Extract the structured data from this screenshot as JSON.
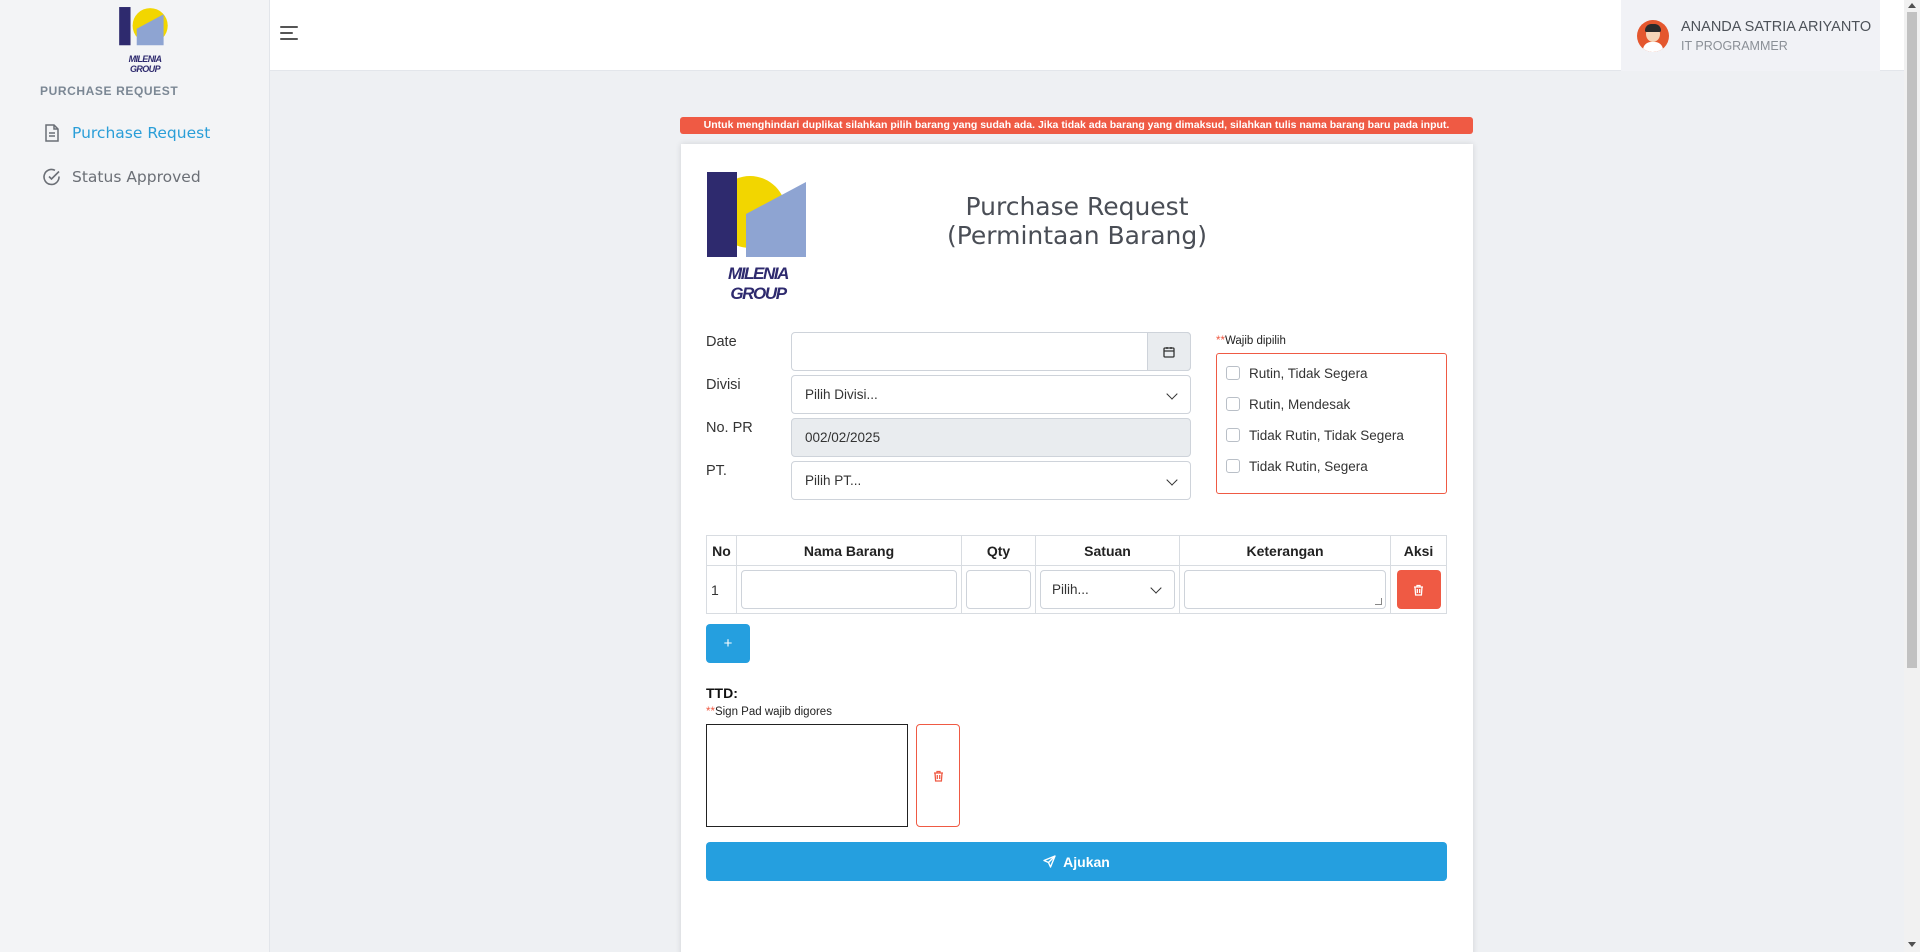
{
  "app": {
    "logo_text": "MILENIA GROUP",
    "brand_colors": {
      "sun": "#f2d600",
      "navy": "#2e2a6e",
      "blue": "#8ea4d2"
    }
  },
  "sidebar": {
    "section_title": "PURCHASE REQUEST",
    "items": [
      {
        "label": "Purchase Request",
        "icon": "document-icon",
        "active": true
      },
      {
        "label": "Status Approved",
        "icon": "check-circle-icon",
        "active": false
      }
    ]
  },
  "topbar": {
    "menu_icon": "hamburger-icon",
    "user": {
      "name": "ANANDA SATRIA ARIYANTO",
      "role": "IT PROGRAMMER"
    }
  },
  "alert": {
    "text": "Untuk menghindari duplikat silahkan pilih barang yang sudah ada. Jika tidak ada barang yang dimaksud, silahkan tulis nama barang baru pada input.",
    "color": "#ef5a44"
  },
  "form": {
    "title_line1": "Purchase Request",
    "title_line2": "(Permintaan Barang)",
    "date": {
      "label": "Date",
      "value": ""
    },
    "divisi": {
      "label": "Divisi",
      "value": "Pilih Divisi..."
    },
    "no_pr": {
      "label": "No. PR",
      "value": "002/02/2025"
    },
    "pt": {
      "label": "PT.",
      "value": "Pilih PT..."
    },
    "priority": {
      "required_mark": "**",
      "note": "Wajib dipilih",
      "options": [
        "Rutin, Tidak Segera",
        "Rutin, Mendesak",
        "Tidak Rutin, Tidak Segera",
        "Tidak Rutin, Segera"
      ]
    },
    "table": {
      "headers": [
        "No",
        "Nama Barang",
        "Qty",
        "Satuan",
        "Keterangan",
        "Aksi"
      ],
      "rows": [
        {
          "no": "1",
          "nama_barang": "",
          "qty": "",
          "satuan": "Pilih...",
          "keterangan": ""
        }
      ]
    },
    "add_row_label": "+",
    "ttd_label": "TTD:",
    "sign_note_mark": "**",
    "sign_note": "Sign Pad wajib digores",
    "submit_label": "Ajukan",
    "accent_color": "#259fdf",
    "danger_color": "#ef5a44"
  }
}
